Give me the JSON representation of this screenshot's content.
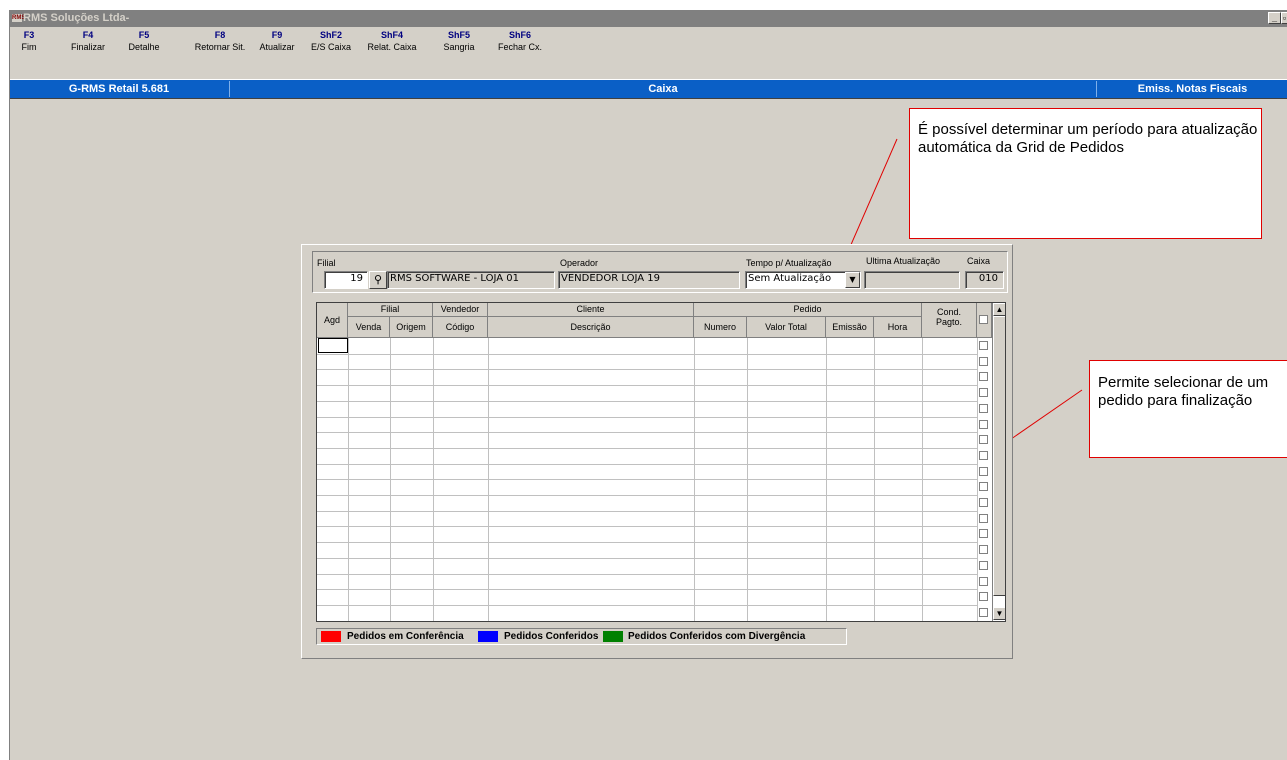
{
  "window": {
    "title": "RMS Soluções Ltda-",
    "logo_text": "RMS"
  },
  "fkeys": [
    {
      "key": "F3",
      "label": "Fim"
    },
    {
      "key": "F4",
      "label": "Finalizar"
    },
    {
      "key": "F5",
      "label": "Detalhe"
    },
    {
      "key": "F8",
      "label": "Retornar Sit."
    },
    {
      "key": "F9",
      "label": "Atualizar"
    },
    {
      "key": "ShF2",
      "label": "E/S Caixa"
    },
    {
      "key": "ShF4",
      "label": "Relat. Caixa"
    },
    {
      "key": "ShF5",
      "label": "Sangria"
    },
    {
      "key": "ShF6",
      "label": "Fechar Cx."
    }
  ],
  "statusbar": {
    "left": "G-RMS Retail 5.681",
    "center": "Caixa",
    "right": "Emiss. Notas Fiscais"
  },
  "callouts": {
    "top": "É possível determinar um período para atualização automática da Grid de Pedidos",
    "right": "Permite selecionar de um pedido para finalização"
  },
  "form": {
    "filial_label": "Filial",
    "filial_value": "19",
    "filial_name": "RMS SOFTWARE - LOJA 01",
    "operador_label": "Operador",
    "operador_value": "VENDEDOR LOJA 19",
    "tempo_label": "Tempo p/ Atualização",
    "tempo_value": "Sem Atualização",
    "ultima_label": "Ultima Atualização",
    "ultima_value": "",
    "caixa_label": "Caixa",
    "caixa_value": "010"
  },
  "grid": {
    "groups": {
      "filial": "Filial",
      "vendedor": "Vendedor",
      "cliente": "Cliente",
      "pedido": "Pedido"
    },
    "columns": {
      "agd": "Agd",
      "venda": "Venda",
      "origem": "Origem",
      "codigo": "Código",
      "descricao": "Descrição",
      "numero": "Numero",
      "valor_total": "Valor Total",
      "emissao": "Emissão",
      "hora": "Hora",
      "cond": "Cond.",
      "pagto": "Pagto."
    },
    "row_count": 18
  },
  "legend": [
    {
      "label": "Pedidos em Conferência",
      "color": "#ff0000"
    },
    {
      "label": "Pedidos Conferidos",
      "color": "#0000ff"
    },
    {
      "label": "Pedidos Conferidos com Divergência",
      "color": "#008000"
    }
  ],
  "colors": {
    "statusbar": "#0a5fc6",
    "callout_border": "#e00000",
    "window_bg": "#d4d0c8"
  }
}
